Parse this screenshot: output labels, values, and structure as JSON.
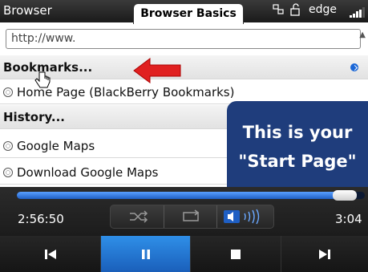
{
  "status_bar": {
    "app_name": "Browser",
    "network": "edge",
    "signal_bars": 4,
    "signal_max": 5
  },
  "tag": {
    "title": "Browser Basics"
  },
  "browser": {
    "url_text": "http://www.",
    "items": [
      {
        "label": "Bookmarks...",
        "type": "section"
      },
      {
        "label": "Home Page (BlackBerry Bookmarks)",
        "type": "link"
      },
      {
        "label": "History...",
        "type": "section"
      },
      {
        "label": "Google Maps",
        "type": "link"
      },
      {
        "label": "Download Google Maps",
        "type": "link"
      }
    ]
  },
  "callout": {
    "line1": "This is your",
    "line2": "\"Start Page\""
  },
  "player": {
    "elapsed": "2:56:50",
    "total": "3:04",
    "progress": 0.94,
    "active_control": "pause",
    "controls": [
      "previous",
      "pause",
      "stop",
      "next"
    ]
  },
  "colors": {
    "accent_blue": "#1a5fba",
    "callout_bg": "#1f3d7c",
    "arrow_red": "#e02020"
  },
  "icons": [
    "shuffle-icon",
    "repeat-icon",
    "volume-icon",
    "globe-icon",
    "hand-cursor-icon",
    "red-arrow-icon"
  ]
}
